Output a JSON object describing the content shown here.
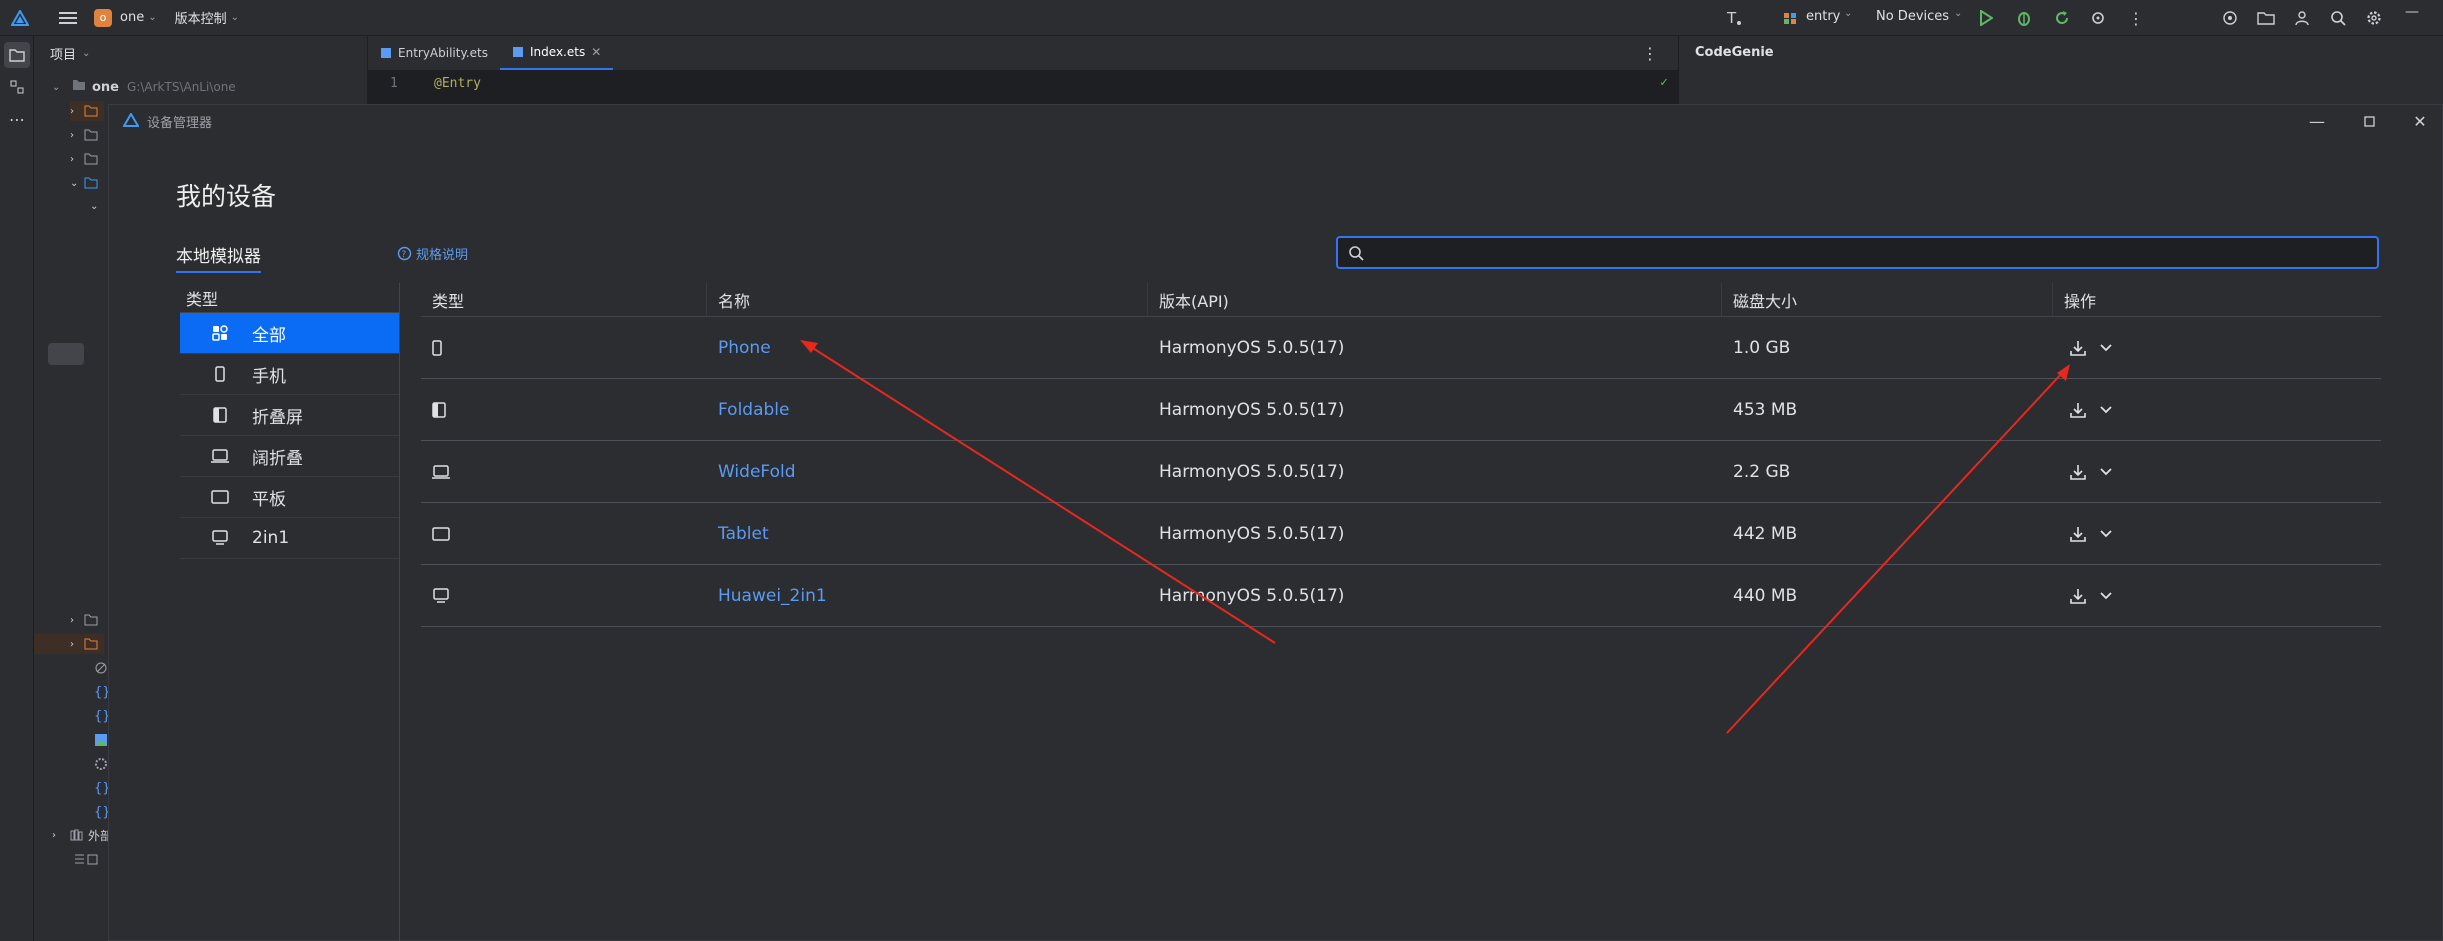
{
  "topbar": {
    "project_badge": "o",
    "project_name": "one",
    "vcs_label": "版本控制",
    "run_config": "entry",
    "device_select": "No Devices"
  },
  "project_panel": {
    "title": "项目",
    "root_name": "one",
    "root_path": "G:\\ArkTS\\AnLi\\one",
    "bottom_item": "外部"
  },
  "editor": {
    "tabs": [
      {
        "label": "EntryAbility.ets"
      },
      {
        "label": "Index.ets"
      }
    ],
    "line_number": "1",
    "code_line": "@Entry"
  },
  "codegenie": {
    "title": "CodeGenie"
  },
  "dialog": {
    "title": "设备管理器",
    "page_title": "我的设备",
    "tab_local": "本地模拟器",
    "spec_link": "规格说明",
    "search": {
      "value": "",
      "placeholder": ""
    },
    "category_header": "类型",
    "categories": [
      {
        "label": "全部",
        "icon": "grid-icon"
      },
      {
        "label": "手机",
        "icon": "phone-icon"
      },
      {
        "label": "折叠屏",
        "icon": "foldable-icon"
      },
      {
        "label": "阔折叠",
        "icon": "widefold-icon"
      },
      {
        "label": "平板",
        "icon": "tablet-icon"
      },
      {
        "label": "2in1",
        "icon": "laptop-icon"
      }
    ],
    "table": {
      "headers": [
        "类型",
        "名称",
        "版本(API)",
        "磁盘大小",
        "操作"
      ],
      "rows": [
        {
          "type_icon": "phone-icon",
          "name": "Phone",
          "version": "HarmonyOS 5.0.5(17)",
          "size": "1.0 GB"
        },
        {
          "type_icon": "foldable-icon",
          "name": "Foldable",
          "version": "HarmonyOS 5.0.5(17)",
          "size": "453 MB"
        },
        {
          "type_icon": "widefold-icon",
          "name": "WideFold",
          "version": "HarmonyOS 5.0.5(17)",
          "size": "2.2 GB"
        },
        {
          "type_icon": "tablet-icon",
          "name": "Tablet",
          "version": "HarmonyOS 5.0.5(17)",
          "size": "442 MB"
        },
        {
          "type_icon": "laptop-icon",
          "name": "Huawei_2in1",
          "version": "HarmonyOS 5.0.5(17)",
          "size": "440 MB"
        }
      ]
    }
  },
  "colors": {
    "accent": "#3574f0",
    "selected_category": "#0a6cf5",
    "link": "#5b9bf4",
    "annotation_arrow": "#e8271f"
  }
}
